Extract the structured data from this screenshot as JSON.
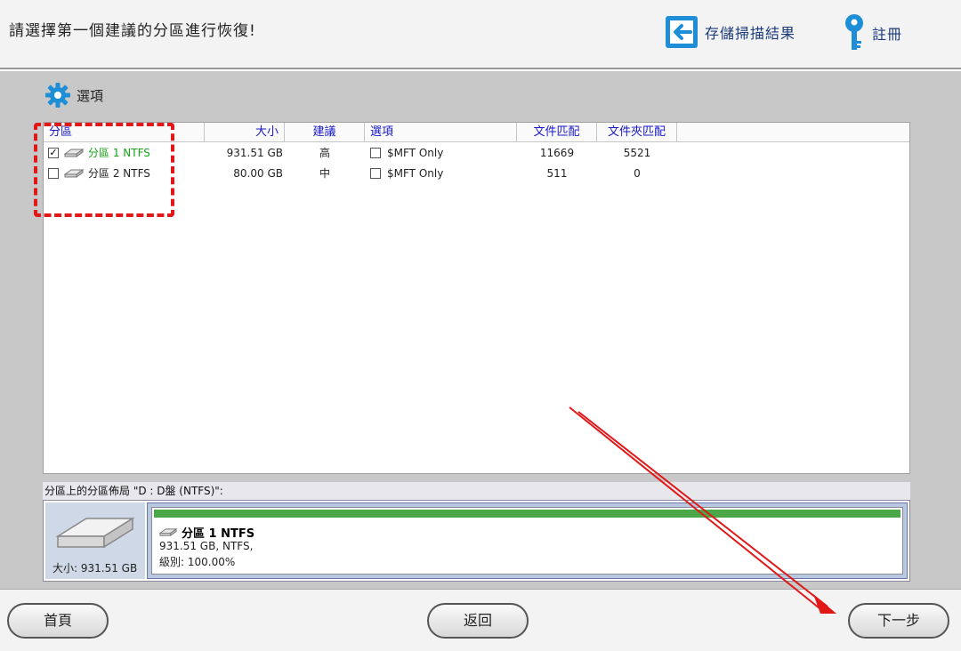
{
  "header": {
    "title": "請選擇第一個建議的分區進行恢復!",
    "save_label": "存儲掃描結果",
    "register_label": "註冊"
  },
  "options": {
    "label": "選項"
  },
  "table": {
    "columns": [
      "分區",
      "大小",
      "建議",
      "選項",
      "文件匹配",
      "文件夾匹配"
    ],
    "rows": [
      {
        "checked": true,
        "name": "分區 1 NTFS",
        "size": "931.51 GB",
        "suggestion": "高",
        "option_checked": false,
        "option": "$MFT Only",
        "file_match": "11669",
        "folder_match": "5521"
      },
      {
        "checked": false,
        "name": "分區 2 NTFS",
        "size": "80.00 GB",
        "suggestion": "中",
        "option_checked": false,
        "option": "$MFT Only",
        "file_match": "511",
        "folder_match": "0"
      }
    ]
  },
  "layout": {
    "label": "分區上的分區佈局 \"D : D盤  (NTFS)\":",
    "disk_size": "大小: 931.51 GB",
    "partition_name": "分區 1 NTFS",
    "partition_info": "931.51 GB, NTFS,",
    "partition_level": "級別: 100.00%"
  },
  "footer": {
    "home_label": "首頁",
    "back_label": "返回",
    "next_label": "下一步"
  },
  "colors": {
    "accent_blue": "#1818c8",
    "highlight_red": "#e01818",
    "green": "#17a317"
  }
}
